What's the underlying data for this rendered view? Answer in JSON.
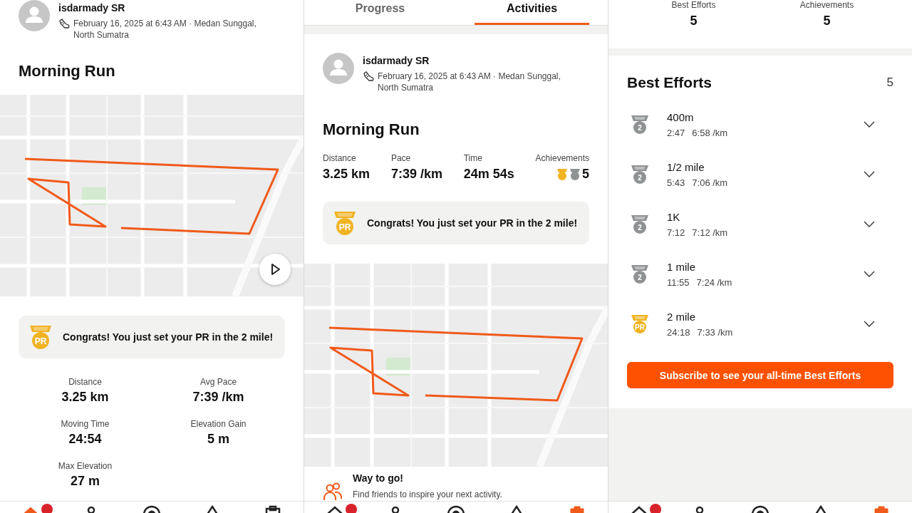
{
  "activity_screen": {
    "athlete": {
      "name": "isdarmady SR",
      "meta": "February 16, 2025 at 6:43 AM · Medan Sunggal, North Sumatra"
    },
    "title": "Morning Run",
    "congrats": {
      "color": "#f0b323",
      "medal_text": "PR",
      "text": "Congrats! You just set your PR in the 2 mile!"
    },
    "stats": [
      {
        "label": "Distance",
        "value": "3.25 km"
      },
      {
        "label": "Avg Pace",
        "value": "7:39 /km"
      },
      {
        "label": "Moving Time",
        "value": "24:54"
      },
      {
        "label": "Elevation Gain",
        "value": "5 m"
      },
      {
        "label": "Max Elevation",
        "value": "27 m"
      }
    ],
    "nav": [
      {
        "kind": "home",
        "selected": true,
        "notification": true
      },
      {
        "kind": "maps",
        "selected": false,
        "notification": false
      },
      {
        "kind": "record",
        "selected": false,
        "notification": false
      },
      {
        "kind": "groups",
        "selected": false,
        "notification": false
      },
      {
        "kind": "you",
        "selected": false,
        "notification": false
      }
    ]
  },
  "feed_screen": {
    "tabs": [
      {
        "label": "Progress",
        "selected": false
      },
      {
        "label": "Activities",
        "selected": true
      }
    ],
    "athlete": {
      "name": "isdarmady SR",
      "meta": "February 16, 2025 at 6:43 AM · Medan Sunggal, North Sumatra"
    },
    "title": "Morning Run",
    "stats": [
      {
        "kind": "plain",
        "label": "Distance",
        "value": "3.25 km"
      },
      {
        "kind": "plain",
        "label": "Pace",
        "value": "7:39 /km"
      },
      {
        "kind": "plain",
        "label": "Time",
        "value": "24m 54s"
      },
      {
        "kind": "achievements",
        "label": "Achievements",
        "value": "5",
        "medals": [
          {
            "color": "#f0b323"
          },
          {
            "color": "#8f9293"
          }
        ]
      }
    ],
    "congrats": {
      "color": "#f0b323",
      "medal_text": "PR",
      "text": "Congrats! You just set your PR in the 2 mile!"
    },
    "prompt": {
      "title": "Way to go!",
      "text": "Find friends to inspire your next activity."
    },
    "nav": [
      {
        "kind": "home",
        "selected": false,
        "notification": true
      },
      {
        "kind": "maps",
        "selected": false,
        "notification": false
      },
      {
        "kind": "record",
        "selected": false,
        "notification": false
      },
      {
        "kind": "groups",
        "selected": false,
        "notification": false
      },
      {
        "kind": "you",
        "selected": true,
        "notification": false
      }
    ]
  },
  "efforts_screen": {
    "summary": [
      {
        "label": "Best Efforts",
        "value": "5"
      },
      {
        "label": "Achievements",
        "value": "5"
      }
    ],
    "section": {
      "title": "Best Efforts",
      "count": "5"
    },
    "efforts": [
      {
        "color": "#8f9293",
        "medal_text": "2",
        "name": "400m",
        "time": "2:47",
        "pace": "6:58 /km",
        "expanded": false
      },
      {
        "color": "#8f9293",
        "medal_text": "2",
        "name": "1/2 mile",
        "time": "5:43",
        "pace": "7:06 /km",
        "expanded": false
      },
      {
        "color": "#8f9293",
        "medal_text": "2",
        "name": "1K",
        "time": "7:12",
        "pace": "7:12 /km",
        "expanded": false
      },
      {
        "color": "#8f9293",
        "medal_text": "2",
        "name": "1 mile",
        "time": "11:55",
        "pace": "7:24 /km",
        "expanded": false
      },
      {
        "color": "#f0b323",
        "medal_text": "PR",
        "name": "2 mile",
        "time": "24:18",
        "pace": "7:33 /km",
        "expanded": false
      }
    ],
    "button": "Subscribe to see your all-time Best Efforts",
    "nav": [
      {
        "kind": "home",
        "selected": false,
        "notification": true
      },
      {
        "kind": "maps",
        "selected": false,
        "notification": false
      },
      {
        "kind": "record",
        "selected": false,
        "notification": false
      },
      {
        "kind": "groups",
        "selected": false,
        "notification": false
      },
      {
        "kind": "you",
        "selected": true,
        "notification": false
      }
    ]
  }
}
